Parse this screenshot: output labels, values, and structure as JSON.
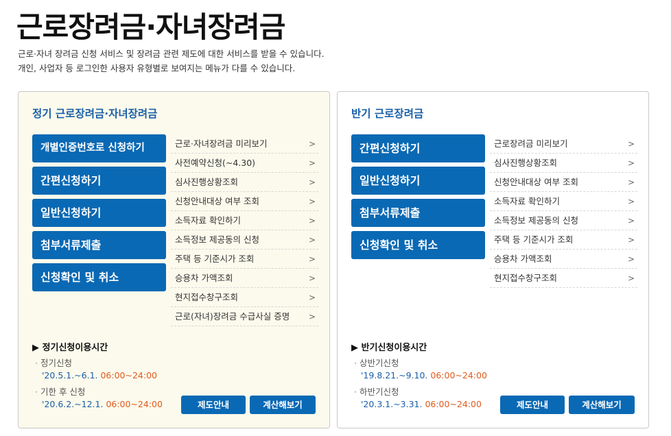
{
  "page": {
    "title": "근로장려금·자녀장려금",
    "desc1": "근로·자녀 장려금 신청 서비스 및 장려금 관련 제도에 대한 서비스를 받을 수 있습니다.",
    "desc2": "개인, 사업자 등 로그인한 사용자 유형별로 보여지는 메뉴가 다를 수 있습니다."
  },
  "regular": {
    "title": "정기 근로장려금·자녀장려금",
    "buttons": [
      "개별인증번호로 신청하기",
      "간편신청하기",
      "일반신청하기",
      "첨부서류제출",
      "신청확인 및 취소"
    ],
    "links": [
      "근로·자녀장려금 미리보기",
      "사전예약신청(~4.30)",
      "심사진행상황조회",
      "신청안내대상 여부 조회",
      "소득자료 확인하기",
      "소득정보 제공동의 신청",
      "주택 등 기준시가 조회",
      "승용차 가액조회",
      "현지접수창구조회",
      "근로(자녀)장려금 수급사실 증명"
    ],
    "period_title": "▶ 정기신청이용시간",
    "periods": [
      {
        "label": "정기신청",
        "dates": "'20.5.1.~6.1.",
        "time": "06:00~24:00"
      },
      {
        "label": "기한 후 신청",
        "dates": "'20.6.2.~12.1.",
        "time": "06:00~24:00"
      }
    ],
    "btn_guide": "제도안내",
    "btn_calc": "계산해보기"
  },
  "half": {
    "title": "반기 근로장려금",
    "buttons": [
      "간편신청하기",
      "일반신청하기",
      "첨부서류제출",
      "신청확인 및 취소"
    ],
    "links": [
      "근로장려금 미리보기",
      "심사진행상황조회",
      "신청안내대상 여부 조회",
      "소득자료 확인하기",
      "소득정보 제공동의 신청",
      "주택 등 기준시가 조회",
      "승용차 가액조회",
      "현지접수창구조회"
    ],
    "period_title": "▶ 반기신청이용시간",
    "periods": [
      {
        "label": "상반기신청",
        "dates": "'19.8.21.~9.10.",
        "time": "06:00~24:00"
      },
      {
        "label": "하반기신청",
        "dates": "'20.3.1.~3.31.",
        "time": "06:00~24:00"
      }
    ],
    "btn_guide": "제도안내",
    "btn_calc": "계산해보기"
  },
  "icons": {
    "chevron": "chevron-right-icon"
  },
  "colors": {
    "primary": "#0a69b4",
    "title_blue": "#1a5fa8",
    "time_orange": "#e05a1c",
    "panel_bg": "#fcfaec"
  }
}
